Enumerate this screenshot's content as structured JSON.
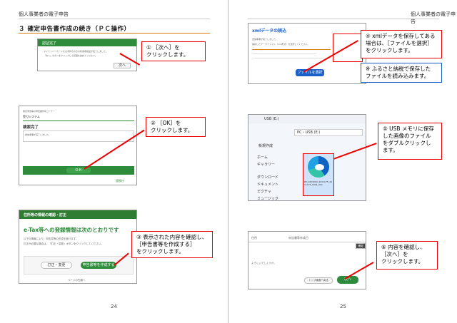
{
  "left_page": {
    "header": "個人事業者の電子申告",
    "section_title": "３ 確定申告書作成の続き（ＰＣ操作）",
    "page_number": "24",
    "shot1": {
      "title": "認証完了",
      "line1": "マイナンバーカードをお手持ちの方の利用者認証が完了しました。",
      "line2": "「次へ」ボタンをクリックして処理を進めてください。",
      "button": "次へ"
    },
    "callout1": "① ［次へ］を\nクリックします。",
    "shot2": {
      "crumb": "確定申告等の申告書作成コーナー",
      "system": "受付システム",
      "title": "検索完了",
      "line1": "送信準備が完了しました。",
      "button": "ＯＫ",
      "footer": "国税庁"
    },
    "callout2": "② ［OK］を\nクリックします。",
    "shot3": {
      "bar": "住所等の情報の確認・訂正",
      "title": "e-Tax等への登録情報は次のとおりです",
      "line1": "以下の情報により、申告書等の作成を続けます。",
      "line2": "訂正が必要な場合は、「訂正・変更」ボタンをクリックしてください。",
      "btn_edit": "訂正・変更",
      "btn_create": "申告書等を作成する",
      "footer": "ページの先頭へ"
    },
    "callout3": "③ 表示された内容を確認し、\n［申告書等を作成する］\nをクリックします。"
  },
  "right_page": {
    "header": "個人事業者の電子申告",
    "page_number": "25",
    "shot4": {
      "title": "xmlデータの読込",
      "line1": "送信準備が完了しました。",
      "line2": "保存したデータファイル（xml形式）を選択してください。",
      "button": "ファイルを選択"
    },
    "callout4": "④ xmlデータを保存してある\n場合は、［ファイルを選択］\nをクリックします。",
    "note": "※ ふるさと納税で保存した\nファイルを読み込みます。",
    "shot5": {
      "tab": "USB (E:)",
      "new": "新規作成",
      "path": "PC › USB (E:)",
      "nav": [
        "ホーム",
        "ギャラリー",
        "ダウンロード",
        "ドキュメント",
        "ピクチャ",
        "ミュージック"
      ],
      "file": "R5_0254000_4411175_4411175_0001_001"
    },
    "callout5": "⑤ USB メモリに保存\nした画像のファイル\nをダブルクリックし\nます。",
    "shot6": {
      "col1": "住所",
      "col2": "申告書等作成日",
      "note": "よろしいでしょうか。",
      "btn_top": "確認",
      "btn_back": "トップ画面へ戻る",
      "btn_next": "次へ"
    },
    "callout6": "⑥ 内容を確認し、\n［次へ］を\nクリックします。"
  }
}
